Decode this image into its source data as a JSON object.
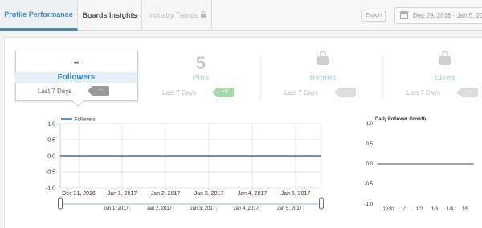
{
  "tabs": [
    {
      "label": "Profile Performance",
      "active": true
    },
    {
      "label": "Boards Insights",
      "active": false
    },
    {
      "label": "Industry Trends",
      "active": false,
      "locked": true
    }
  ],
  "toolbar": {
    "export_label": "Export",
    "date_range": "Dec 29, 2016 - Jan 5, 2017"
  },
  "metrics": [
    {
      "name": "Followers",
      "value": "-",
      "period": "Last 7 Days",
      "change": "--",
      "active": true
    },
    {
      "name": "Pins",
      "value": "5",
      "period": "Last 7 Days",
      "change": "+5"
    },
    {
      "name": "Repins",
      "locked": true,
      "period": "Last 7 Days",
      "change": "--"
    },
    {
      "name": "Likes",
      "locked": true,
      "period": "Last 7 Days",
      "change": "--"
    }
  ],
  "colors": {
    "accent": "#4a87b7",
    "series_line": "#4a6f8a",
    "positive": "#a8d7a8"
  },
  "chart_data": [
    {
      "type": "line",
      "legend": "Followers",
      "series": [
        {
          "name": "Followers",
          "x": [
            "Dec 31, 2016",
            "Jan 1, 2017",
            "Jan 2, 2017",
            "Jan 3, 2017",
            "Jan 4, 2017",
            "Jan 5, 2017"
          ],
          "values": [
            0,
            0,
            0,
            0,
            0,
            0
          ]
        }
      ],
      "yticks": [
        "1.0",
        "0.5",
        "0.0",
        "-0.5",
        "-1.0"
      ],
      "ylim": [
        -1,
        1
      ],
      "grid": true,
      "navigator_labels": [
        "Jan 1, 2017",
        "Jan 2, 2017",
        "Jan 3, 2017",
        "Jan 4, 2017",
        "Jan 5, 2017"
      ]
    },
    {
      "type": "line",
      "title": "Daily Follower Growth",
      "categories": [
        "12/31",
        "1/1",
        "1/2",
        "1/3",
        "1/4",
        "1/5"
      ],
      "values": [
        0,
        0,
        0,
        0,
        0,
        0
      ],
      "yticks": [
        "1.0",
        "0.5",
        "0.0",
        "-0.5",
        "-1.0"
      ],
      "ylim": [
        -1,
        1
      ]
    }
  ]
}
